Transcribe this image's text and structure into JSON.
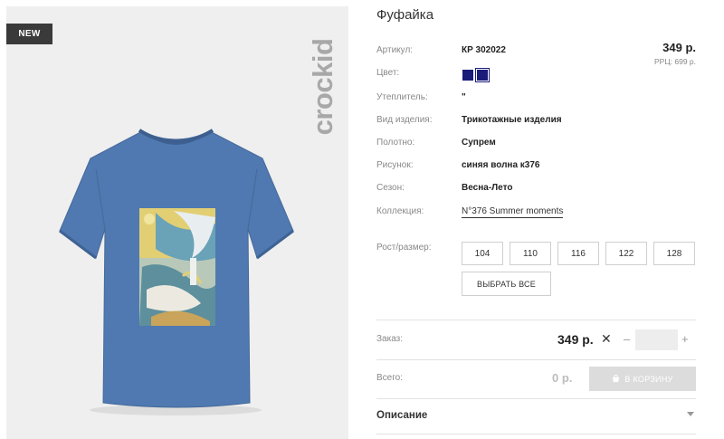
{
  "badge": "NEW",
  "brand": "crockid",
  "product": {
    "title": "Фуфайка",
    "price": "349 р.",
    "rrp": "РРЦ: 699 р."
  },
  "specs": {
    "article": {
      "label": "Артикул:",
      "value": "КР 302022"
    },
    "color": {
      "label": "Цвет:",
      "swatches": [
        "#1b1b7a",
        "#1b1b7a"
      ]
    },
    "insulation": {
      "label": "Утеплитель:",
      "value": "\""
    },
    "type": {
      "label": "Вид изделия:",
      "value": "Трикотажные изделия"
    },
    "fabric": {
      "label": "Полотно:",
      "value": "Супрем"
    },
    "print": {
      "label": "Рисунок:",
      "value": "синяя волна к376"
    },
    "season": {
      "label": "Сезон:",
      "value": "Весна-Лето"
    },
    "collection": {
      "label": "Коллекция:",
      "value": "N°376 Summer moments"
    }
  },
  "sizes": {
    "label": "Рост/размер:",
    "options": [
      "104",
      "110",
      "116",
      "122",
      "128"
    ],
    "select_all": "ВЫБРАТЬ ВСЕ"
  },
  "order": {
    "label": "Заказ:",
    "price": "349 р.",
    "times": "✕",
    "minus": "–",
    "plus": "+",
    "quantity": ""
  },
  "total": {
    "label": "Всего:",
    "value": "0 р.",
    "cart_button": "В КОРЗИНУ"
  },
  "description": {
    "label": "Описание"
  }
}
